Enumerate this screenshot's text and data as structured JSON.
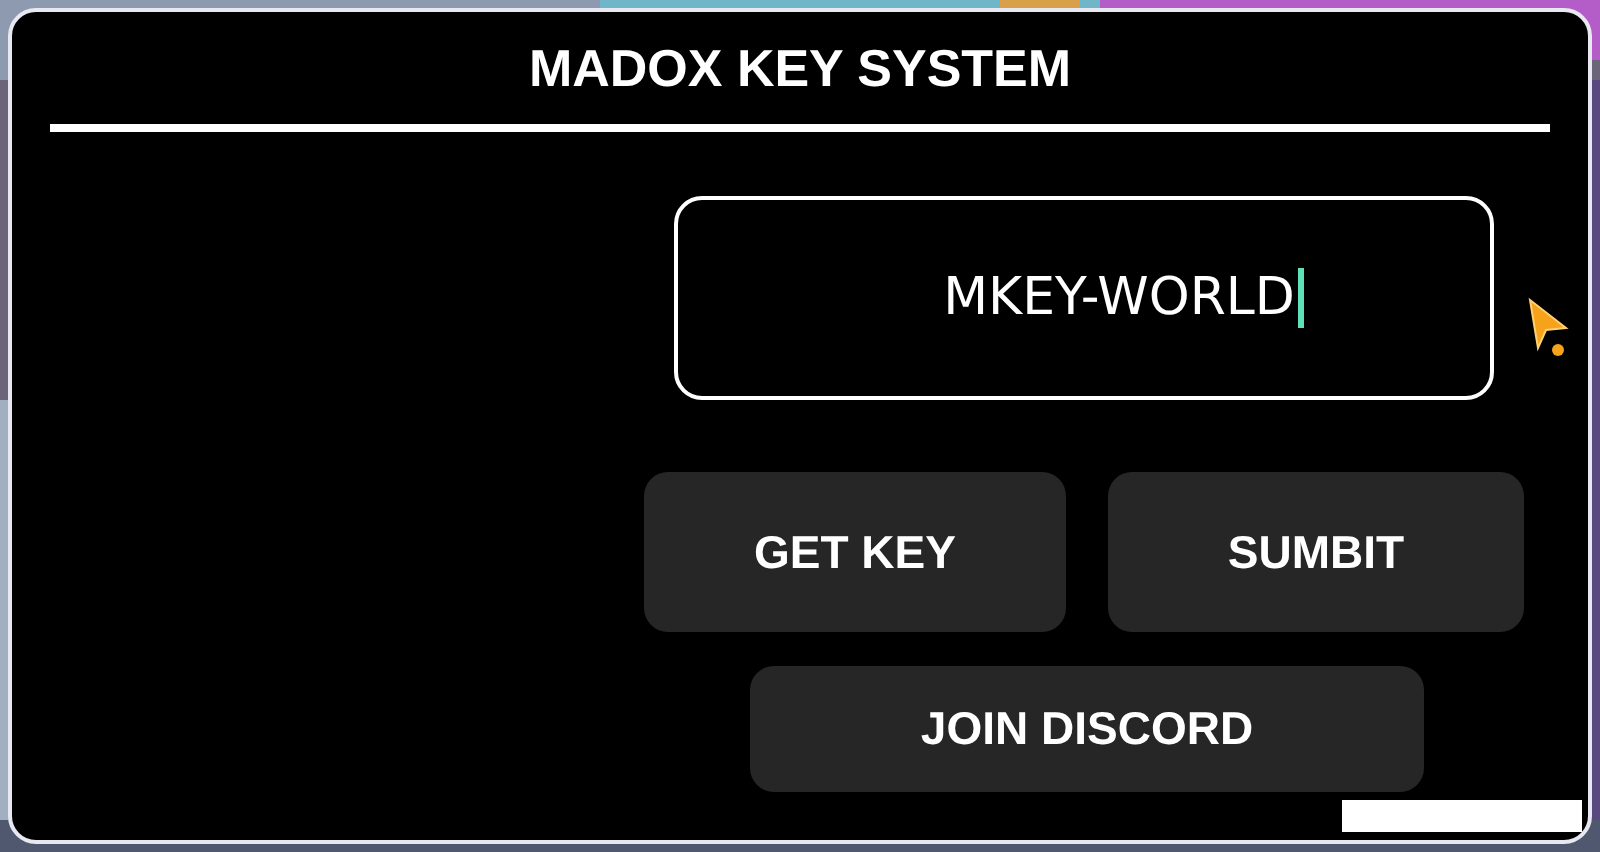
{
  "window": {
    "title": "MADOX KEY SYSTEM"
  },
  "key_field": {
    "value": "MKEY-WORLD"
  },
  "buttons": [
    {
      "label": "GET KEY"
    },
    {
      "label": "SUMBIT"
    },
    {
      "label": "JOIN DISCORD"
    }
  ]
}
